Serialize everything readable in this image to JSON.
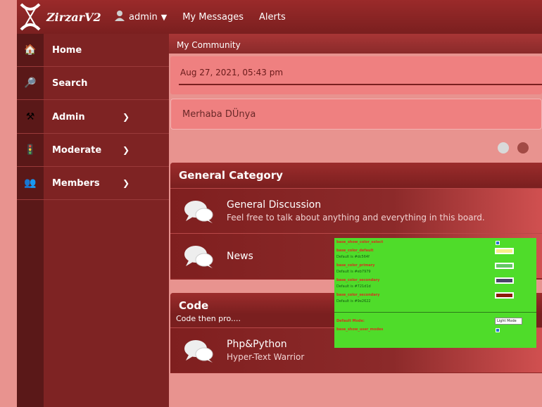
{
  "topbar": {
    "brand": "ZirzarV2",
    "user": "admin",
    "links": [
      "My Messages",
      "Alerts"
    ]
  },
  "sidebar": {
    "items": [
      {
        "label": "Home",
        "icon": "home-icon",
        "expandable": false
      },
      {
        "label": "Search",
        "icon": "search-icon",
        "expandable": false
      },
      {
        "label": "Admin",
        "icon": "tools-icon",
        "expandable": true
      },
      {
        "label": "Moderate",
        "icon": "traffic-light-icon",
        "expandable": true
      },
      {
        "label": "Members",
        "icon": "members-icon",
        "expandable": true
      }
    ]
  },
  "main": {
    "breadcrumb": "My Community",
    "date": "Aug 27, 2021, 05:43 pm",
    "message": "Merhaba DÜnya",
    "categories": [
      {
        "title": "General Category",
        "forums": [
          {
            "title": "General Discussion",
            "desc": "Feel free to talk about anything and everything in this board."
          },
          {
            "title": "News",
            "desc": ""
          }
        ]
      },
      {
        "title": "Code",
        "subtitle": "Code then pro....",
        "forums": [
          {
            "title": "Php&Python",
            "desc": "Hyper-Text Warrior"
          }
        ]
      }
    ]
  },
  "overlay": {
    "rows": [
      {
        "label": "base_show_color_select",
        "sub": ""
      },
      {
        "label": "base_color_default",
        "sub": "Default is #dc564f"
      },
      {
        "label": "base_color_primary",
        "sub": "Default is #eb7979"
      },
      {
        "label": "base_color_secondary",
        "sub": "Default is #721d1d"
      },
      {
        "label": "base_color_secondary",
        "sub": "Default is #9e2622"
      }
    ],
    "swatches": [
      "#f7f08a",
      "#64c864",
      "#4a4468",
      "#8c1a0a"
    ],
    "mode_label": "Default Mode:",
    "mode_value": "Light Mode",
    "user_modes_label": "base_show_user_modes"
  },
  "colors": {
    "accent": "#8a2424",
    "dot_inactive": "#d9d9d9",
    "dot_active": "#a24a45"
  }
}
